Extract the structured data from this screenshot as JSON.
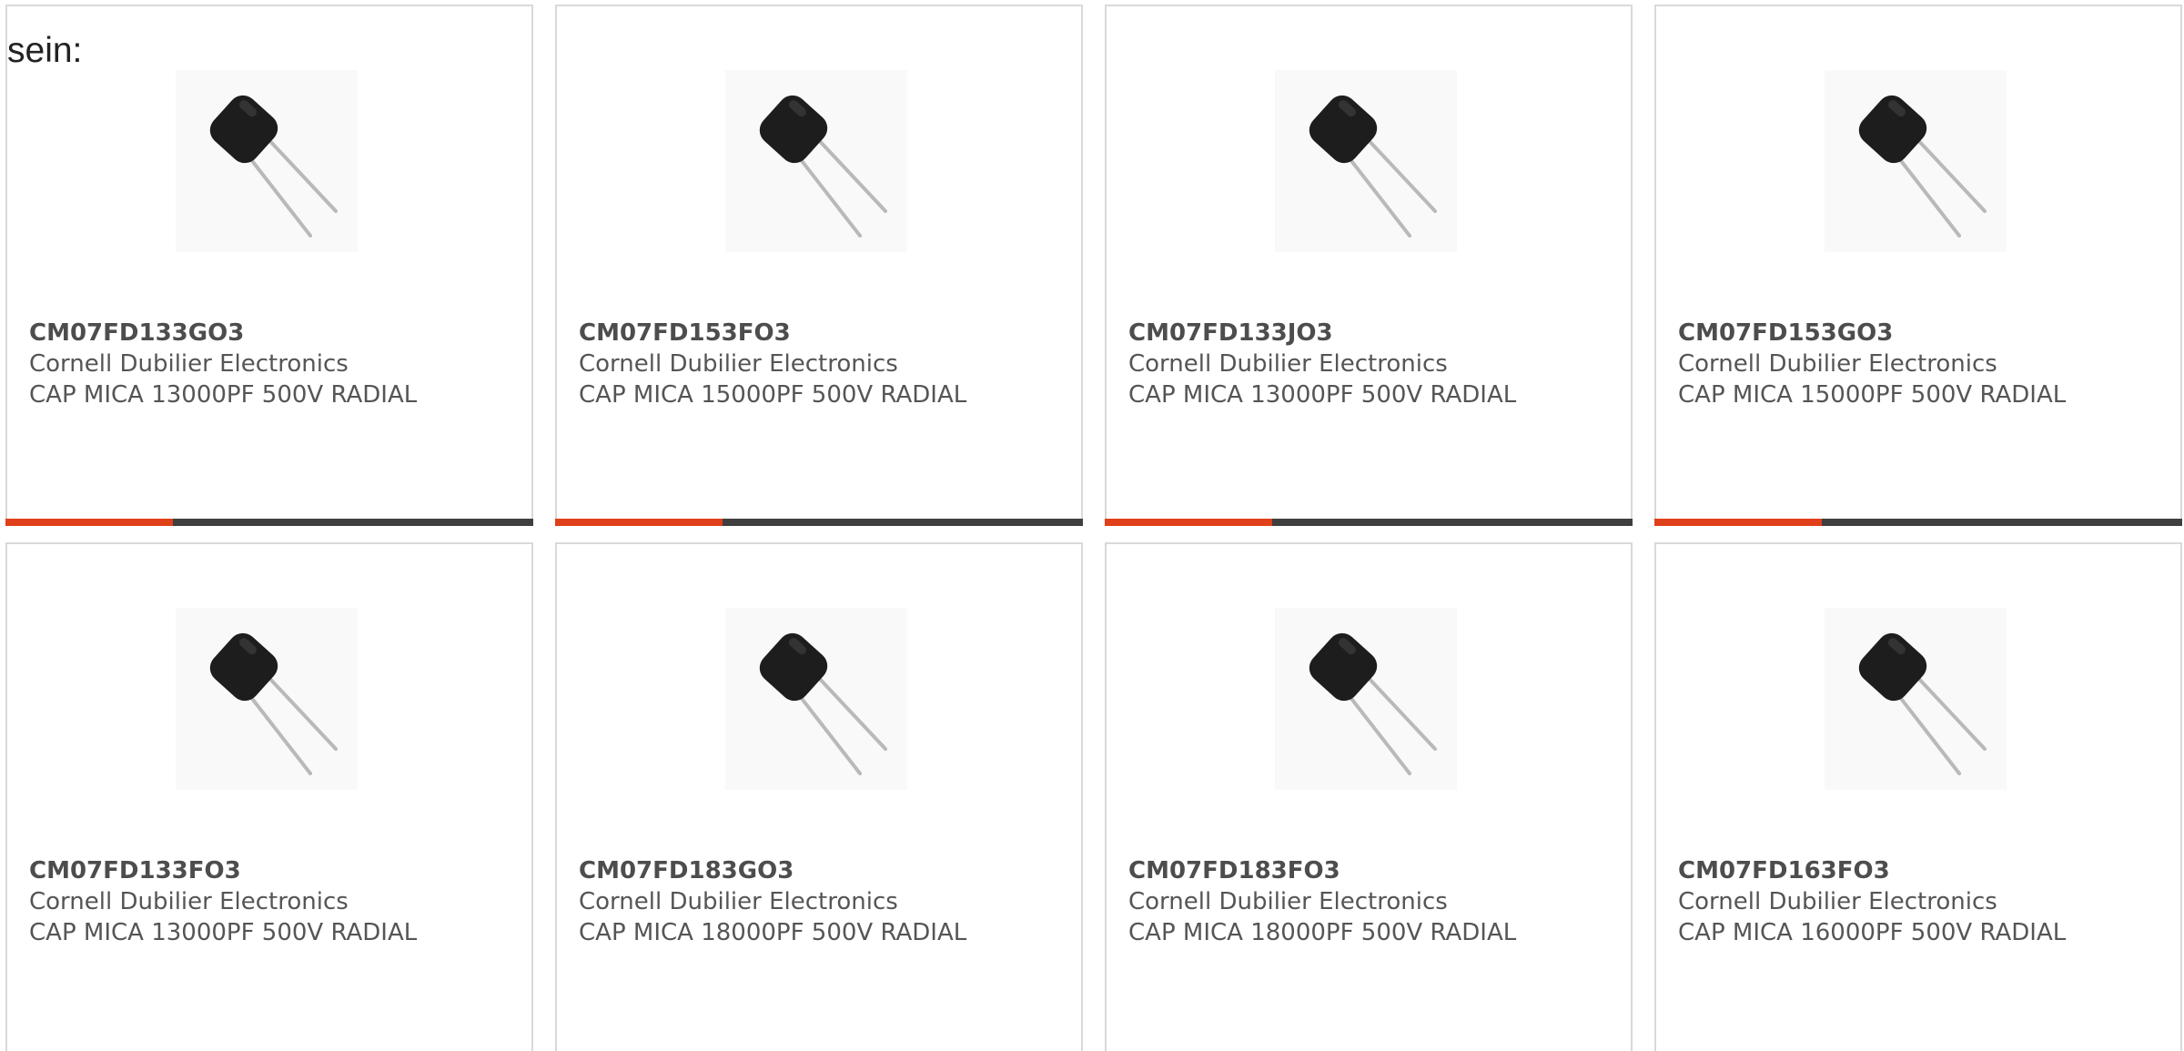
{
  "intro_text": "sein:",
  "colors": {
    "accent": "#e0401a",
    "bar": "#3f3f3f",
    "border": "#d9d9d9",
    "text": "#555555"
  },
  "products": [
    {
      "part_number": "CM07FD133GO3",
      "manufacturer": "Cornell Dubilier Electronics",
      "description": "CAP MICA 13000PF 500V RADIAL",
      "image_icon": "radial-capacitor-image"
    },
    {
      "part_number": "CM07FD153FO3",
      "manufacturer": "Cornell Dubilier Electronics",
      "description": "CAP MICA 15000PF 500V RADIAL",
      "image_icon": "radial-capacitor-image"
    },
    {
      "part_number": "CM07FD133JO3",
      "manufacturer": "Cornell Dubilier Electronics",
      "description": "CAP MICA 13000PF 500V RADIAL",
      "image_icon": "radial-capacitor-image"
    },
    {
      "part_number": "CM07FD153GO3",
      "manufacturer": "Cornell Dubilier Electronics",
      "description": "CAP MICA 15000PF 500V RADIAL",
      "image_icon": "radial-capacitor-image"
    },
    {
      "part_number": "CM07FD133FO3",
      "manufacturer": "Cornell Dubilier Electronics",
      "description": "CAP MICA 13000PF 500V RADIAL",
      "image_icon": "radial-capacitor-image"
    },
    {
      "part_number": "CM07FD183GO3",
      "manufacturer": "Cornell Dubilier Electronics",
      "description": "CAP MICA 18000PF 500V RADIAL",
      "image_icon": "radial-capacitor-image"
    },
    {
      "part_number": "CM07FD183FO3",
      "manufacturer": "Cornell Dubilier Electronics",
      "description": "CAP MICA 18000PF 500V RADIAL",
      "image_icon": "radial-capacitor-image"
    },
    {
      "part_number": "CM07FD163FO3",
      "manufacturer": "Cornell Dubilier Electronics",
      "description": "CAP MICA 16000PF 500V RADIAL",
      "image_icon": "radial-capacitor-image"
    }
  ]
}
